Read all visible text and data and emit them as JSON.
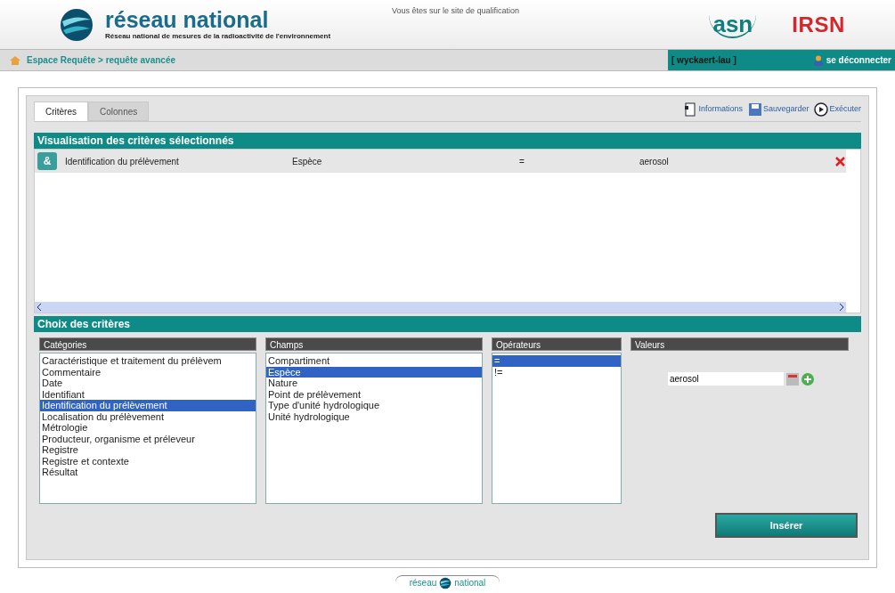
{
  "header": {
    "logo_title": "réseau national",
    "logo_subtitle": "Réseau national de mesures de la radioactivité de l'environnement",
    "site_notice": "Vous êtes sur le site de qualification",
    "partner_logos": [
      "asn",
      "IRSN"
    ]
  },
  "navbar": {
    "breadcrumb": "Espace Requête > requête avancée",
    "user": "[ wyckaert-lau ]",
    "logout": "se déconnecter"
  },
  "tabs": [
    {
      "label": "Critères",
      "selected": true
    },
    {
      "label": "Colonnes",
      "selected": false
    }
  ],
  "toolbar": [
    "Informations",
    "Sauvegarder",
    "Exécuter"
  ],
  "selected_criteria": {
    "title": "Visualisation des critères sélectionnés",
    "rows": [
      {
        "badge": "&",
        "category": "Identification du prélèvement",
        "field": "Espèce",
        "operator": "=",
        "value": "aerosol"
      }
    ]
  },
  "criteria_choice": {
    "title": "Choix des critères",
    "categories": {
      "title": "Catégories",
      "items": [
        {
          "label": "Caractéristique et traitement du prélèvem",
          "selected": false
        },
        {
          "label": "Commentaire",
          "selected": false
        },
        {
          "label": "Date",
          "selected": false
        },
        {
          "label": "Identifiant",
          "selected": false
        },
        {
          "label": "Identification du prélèvement",
          "selected": true
        },
        {
          "label": "Localisation du prélèvement",
          "selected": false
        },
        {
          "label": "Métrologie",
          "selected": false
        },
        {
          "label": "Producteur, organisme et préleveur",
          "selected": false
        },
        {
          "label": "Registre",
          "selected": false
        },
        {
          "label": "Registre et contexte",
          "selected": false
        },
        {
          "label": "Résultat",
          "selected": false
        }
      ]
    },
    "fields": {
      "title": "Champs",
      "items": [
        {
          "label": "Compartiment",
          "selected": false
        },
        {
          "label": "Espèce",
          "selected": true
        },
        {
          "label": "Nature",
          "selected": false
        },
        {
          "label": "Point de prélèvement",
          "selected": false
        },
        {
          "label": "Type d'unité hydrologique",
          "selected": false
        },
        {
          "label": "Unité hydrologique",
          "selected": false
        }
      ]
    },
    "operators": {
      "title": "Opérateurs",
      "items": [
        {
          "label": "=",
          "selected": true
        },
        {
          "label": "!=",
          "selected": false
        }
      ]
    },
    "values": {
      "title": "Valeurs",
      "value": "aerosol"
    },
    "insert_button": "Insérer"
  },
  "footer": {
    "logo_left": "réseau",
    "logo_right": "national"
  }
}
